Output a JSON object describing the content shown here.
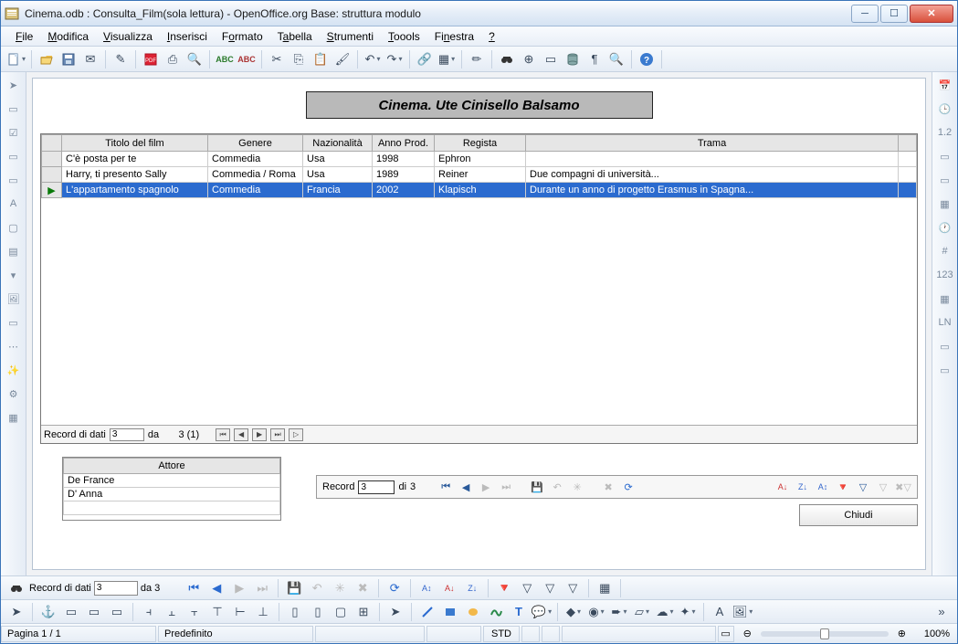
{
  "window": {
    "title": "Cinema.odb : Consulta_Film(sola lettura) - OpenOffice.org Base: struttura modulo"
  },
  "menu": [
    "File",
    "Modifica",
    "Visualizza",
    "Inserisci",
    "Formato",
    "Tabella",
    "Strumenti",
    "Toools",
    "Finestra",
    "?"
  ],
  "form": {
    "heading": "Cinema. Ute Cinisello Balsamo"
  },
  "grid": {
    "columns": [
      "Titolo del film",
      "Genere",
      "Nazionalità",
      "Anno Prod.",
      "Regista",
      "Trama"
    ],
    "rows": [
      {
        "titolo": "C'è posta per te",
        "genere": "Commedia",
        "naz": "Usa",
        "anno": "1998",
        "regista": "Ephron",
        "trama": ""
      },
      {
        "titolo": "Harry, ti presento Sally",
        "genere": "Commedia / Roma",
        "naz": "Usa",
        "anno": "1989",
        "regista": "Reiner",
        "trama": "Due compagni di università..."
      },
      {
        "titolo": "L'appartamento spagnolo",
        "genere": "Commedia",
        "naz": "Francia",
        "anno": "2002",
        "regista": "Klapisch",
        "trama": "Durante un anno di progetto Erasmus in Spagna..."
      }
    ],
    "nav": {
      "label": "Record di dati",
      "current": "3",
      "of_label": "da",
      "total": "3 (1)"
    }
  },
  "actors": {
    "header": "Attore",
    "rows": [
      "De France",
      "D' Anna"
    ]
  },
  "recbar": {
    "label": "Record",
    "current": "3",
    "of_label": "di",
    "total": "3"
  },
  "buttons": {
    "close": "Chiudi"
  },
  "bottom_nav": {
    "label": "Record di dati",
    "current": "3",
    "of_label": "da",
    "total": "3"
  },
  "status": {
    "page": "Pagina 1 / 1",
    "style": "Predefinito",
    "mode": "STD",
    "zoom": "100%"
  }
}
